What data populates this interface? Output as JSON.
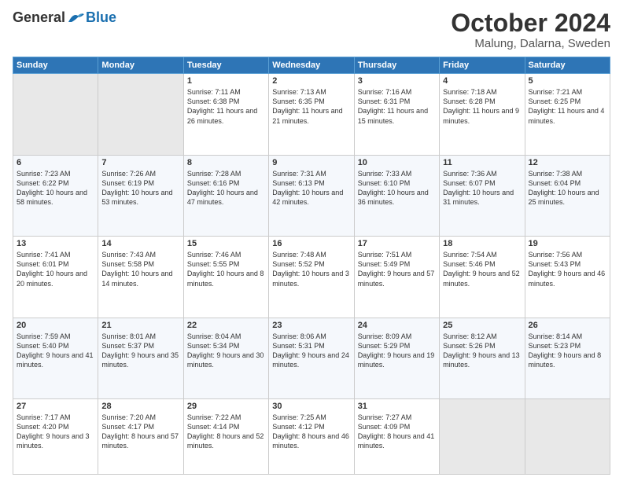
{
  "header": {
    "logo_general": "General",
    "logo_blue": "Blue",
    "month_title": "October 2024",
    "location": "Malung, Dalarna, Sweden"
  },
  "weekdays": [
    "Sunday",
    "Monday",
    "Tuesday",
    "Wednesday",
    "Thursday",
    "Friday",
    "Saturday"
  ],
  "weeks": [
    [
      {
        "day": "",
        "info": ""
      },
      {
        "day": "",
        "info": ""
      },
      {
        "day": "1",
        "info": "Sunrise: 7:11 AM\nSunset: 6:38 PM\nDaylight: 11 hours and 26 minutes."
      },
      {
        "day": "2",
        "info": "Sunrise: 7:13 AM\nSunset: 6:35 PM\nDaylight: 11 hours and 21 minutes."
      },
      {
        "day": "3",
        "info": "Sunrise: 7:16 AM\nSunset: 6:31 PM\nDaylight: 11 hours and 15 minutes."
      },
      {
        "day": "4",
        "info": "Sunrise: 7:18 AM\nSunset: 6:28 PM\nDaylight: 11 hours and 9 minutes."
      },
      {
        "day": "5",
        "info": "Sunrise: 7:21 AM\nSunset: 6:25 PM\nDaylight: 11 hours and 4 minutes."
      }
    ],
    [
      {
        "day": "6",
        "info": "Sunrise: 7:23 AM\nSunset: 6:22 PM\nDaylight: 10 hours and 58 minutes."
      },
      {
        "day": "7",
        "info": "Sunrise: 7:26 AM\nSunset: 6:19 PM\nDaylight: 10 hours and 53 minutes."
      },
      {
        "day": "8",
        "info": "Sunrise: 7:28 AM\nSunset: 6:16 PM\nDaylight: 10 hours and 47 minutes."
      },
      {
        "day": "9",
        "info": "Sunrise: 7:31 AM\nSunset: 6:13 PM\nDaylight: 10 hours and 42 minutes."
      },
      {
        "day": "10",
        "info": "Sunrise: 7:33 AM\nSunset: 6:10 PM\nDaylight: 10 hours and 36 minutes."
      },
      {
        "day": "11",
        "info": "Sunrise: 7:36 AM\nSunset: 6:07 PM\nDaylight: 10 hours and 31 minutes."
      },
      {
        "day": "12",
        "info": "Sunrise: 7:38 AM\nSunset: 6:04 PM\nDaylight: 10 hours and 25 minutes."
      }
    ],
    [
      {
        "day": "13",
        "info": "Sunrise: 7:41 AM\nSunset: 6:01 PM\nDaylight: 10 hours and 20 minutes."
      },
      {
        "day": "14",
        "info": "Sunrise: 7:43 AM\nSunset: 5:58 PM\nDaylight: 10 hours and 14 minutes."
      },
      {
        "day": "15",
        "info": "Sunrise: 7:46 AM\nSunset: 5:55 PM\nDaylight: 10 hours and 8 minutes."
      },
      {
        "day": "16",
        "info": "Sunrise: 7:48 AM\nSunset: 5:52 PM\nDaylight: 10 hours and 3 minutes."
      },
      {
        "day": "17",
        "info": "Sunrise: 7:51 AM\nSunset: 5:49 PM\nDaylight: 9 hours and 57 minutes."
      },
      {
        "day": "18",
        "info": "Sunrise: 7:54 AM\nSunset: 5:46 PM\nDaylight: 9 hours and 52 minutes."
      },
      {
        "day": "19",
        "info": "Sunrise: 7:56 AM\nSunset: 5:43 PM\nDaylight: 9 hours and 46 minutes."
      }
    ],
    [
      {
        "day": "20",
        "info": "Sunrise: 7:59 AM\nSunset: 5:40 PM\nDaylight: 9 hours and 41 minutes."
      },
      {
        "day": "21",
        "info": "Sunrise: 8:01 AM\nSunset: 5:37 PM\nDaylight: 9 hours and 35 minutes."
      },
      {
        "day": "22",
        "info": "Sunrise: 8:04 AM\nSunset: 5:34 PM\nDaylight: 9 hours and 30 minutes."
      },
      {
        "day": "23",
        "info": "Sunrise: 8:06 AM\nSunset: 5:31 PM\nDaylight: 9 hours and 24 minutes."
      },
      {
        "day": "24",
        "info": "Sunrise: 8:09 AM\nSunset: 5:29 PM\nDaylight: 9 hours and 19 minutes."
      },
      {
        "day": "25",
        "info": "Sunrise: 8:12 AM\nSunset: 5:26 PM\nDaylight: 9 hours and 13 minutes."
      },
      {
        "day": "26",
        "info": "Sunrise: 8:14 AM\nSunset: 5:23 PM\nDaylight: 9 hours and 8 minutes."
      }
    ],
    [
      {
        "day": "27",
        "info": "Sunrise: 7:17 AM\nSunset: 4:20 PM\nDaylight: 9 hours and 3 minutes."
      },
      {
        "day": "28",
        "info": "Sunrise: 7:20 AM\nSunset: 4:17 PM\nDaylight: 8 hours and 57 minutes."
      },
      {
        "day": "29",
        "info": "Sunrise: 7:22 AM\nSunset: 4:14 PM\nDaylight: 8 hours and 52 minutes."
      },
      {
        "day": "30",
        "info": "Sunrise: 7:25 AM\nSunset: 4:12 PM\nDaylight: 8 hours and 46 minutes."
      },
      {
        "day": "31",
        "info": "Sunrise: 7:27 AM\nSunset: 4:09 PM\nDaylight: 8 hours and 41 minutes."
      },
      {
        "day": "",
        "info": ""
      },
      {
        "day": "",
        "info": ""
      }
    ]
  ]
}
